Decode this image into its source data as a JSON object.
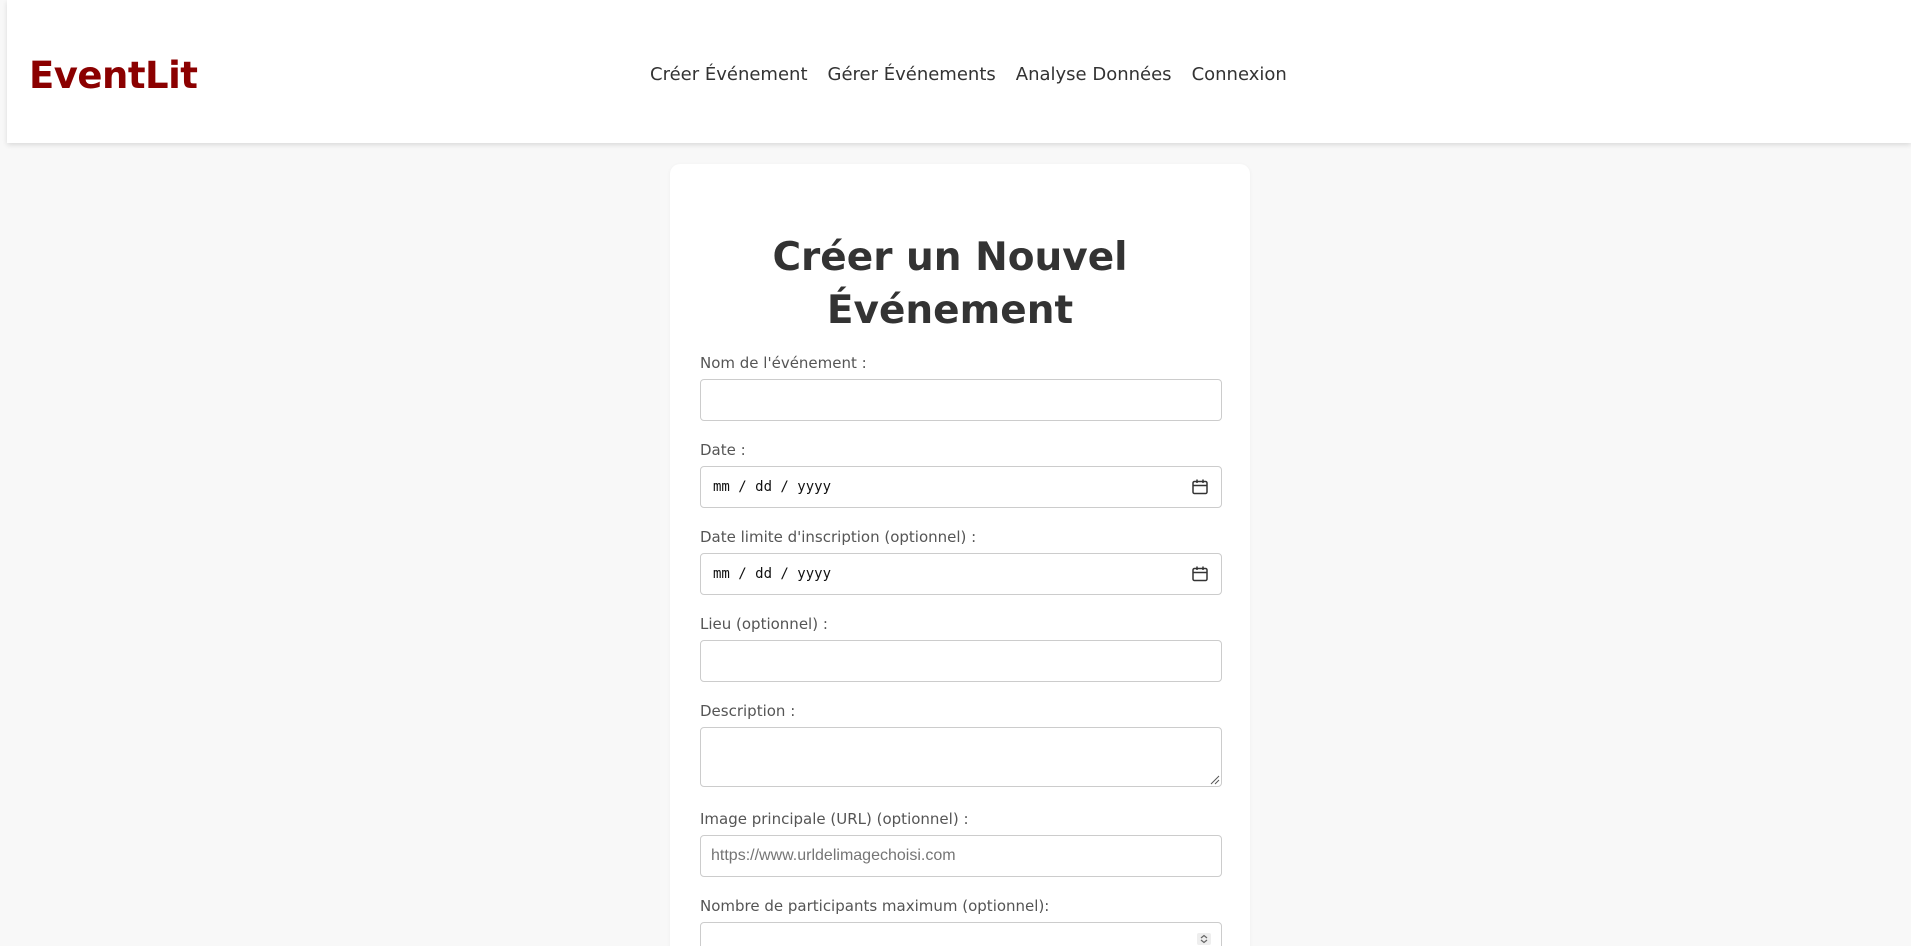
{
  "brand": {
    "name": "EventLit",
    "color": "#8b0000"
  },
  "nav": {
    "items": [
      {
        "label": "Créer Événement"
      },
      {
        "label": "Gérer Événements"
      },
      {
        "label": "Analyse Données"
      },
      {
        "label": "Connexion"
      }
    ]
  },
  "form": {
    "title_line1": "Créer un Nouvel",
    "title_line2": "Événement",
    "event_name": {
      "label": "Nom de l'événement :",
      "value": ""
    },
    "date": {
      "label": "Date :",
      "value": "mm / dd / yyyy",
      "icon": "calendar-icon"
    },
    "registration_deadline": {
      "label": "Date limite d'inscription (optionnel) :",
      "value": "mm / dd / yyyy",
      "icon": "calendar-icon"
    },
    "location": {
      "label": "Lieu (optionnel) :",
      "value": ""
    },
    "description": {
      "label": "Description :",
      "value": ""
    },
    "main_image": {
      "label": "Image principale (URL) (optionnel) :",
      "placeholder": "https://www.urldelimagechoisi.com",
      "value": ""
    },
    "max_participants": {
      "label": "Nombre de participants maximum (optionnel):",
      "value": ""
    }
  }
}
